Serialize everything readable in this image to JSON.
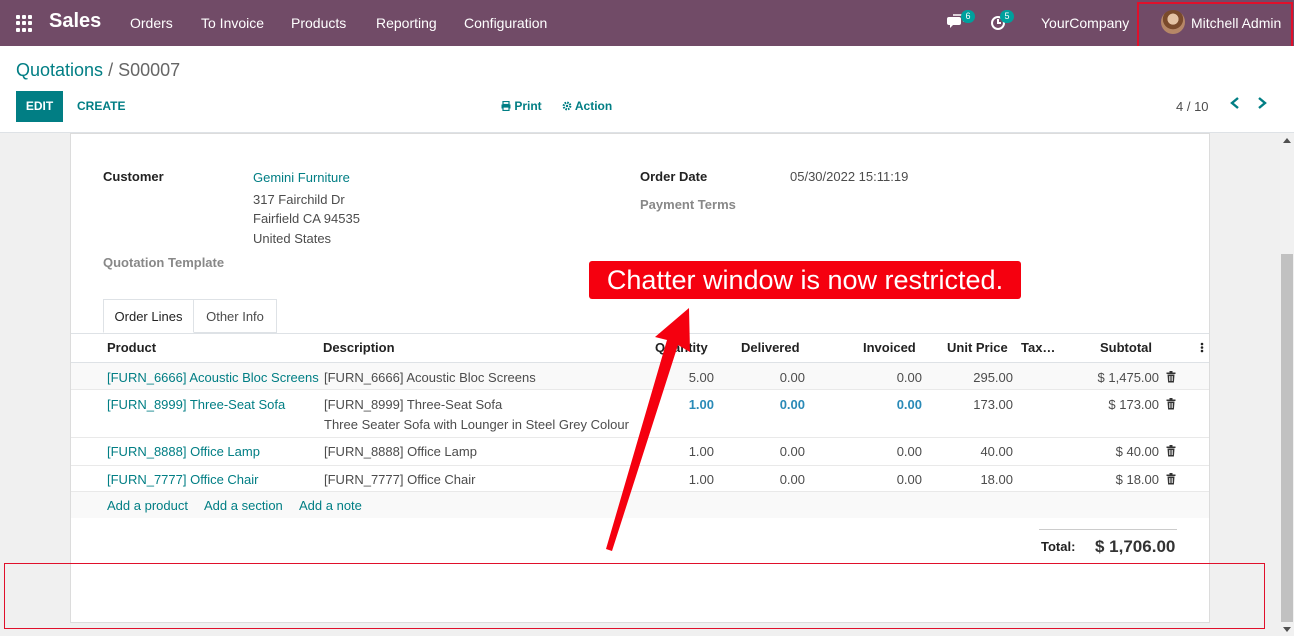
{
  "navbar": {
    "brand": "Sales",
    "menus": [
      "Orders",
      "To Invoice",
      "Products",
      "Reporting",
      "Configuration"
    ],
    "messages_badge": "6",
    "activities_badge": "5",
    "company": "YourCompany",
    "user": "Mitchell Admin",
    "color": "#714b67"
  },
  "breadcrumb": {
    "parent": "Quotations",
    "separator": "/",
    "current": "S00007"
  },
  "toolbar": {
    "edit": "EDIT",
    "create": "CREATE",
    "print": "Print",
    "action": "Action"
  },
  "pager": {
    "value": "4 / 10"
  },
  "form": {
    "customer_label": "Customer",
    "customer_name": "Gemini Furniture",
    "address_line1": "317 Fairchild Dr",
    "address_line2": "Fairfield CA 94535",
    "address_line3": "United States",
    "quotation_template_label": "Quotation Template",
    "order_date_label": "Order Date",
    "order_date": "05/30/2022 15:11:19",
    "payment_terms_label": "Payment Terms"
  },
  "tabs": [
    "Order Lines",
    "Other Info"
  ],
  "table": {
    "headers": {
      "product": "Product",
      "description": "Description",
      "quantity": "Quantity",
      "delivered": "Delivered",
      "invoiced": "Invoiced",
      "unit_price": "Unit Price",
      "taxes": "Tax…",
      "subtotal": "Subtotal"
    },
    "rows": [
      {
        "product": "[FURN_6666] Acoustic Bloc Screens",
        "description": "[FURN_6666] Acoustic Bloc Screens",
        "description2": "",
        "quantity": "5.00",
        "delivered": "0.00",
        "invoiced": "0.00",
        "unit_price": "295.00",
        "subtotal": "$ 1,475.00"
      },
      {
        "product": "[FURN_8999] Three-Seat Sofa",
        "description": "[FURN_8999] Three-Seat Sofa",
        "description2": "Three Seater Sofa with Lounger in Steel Grey Colour",
        "quantity": "1.00",
        "delivered": "0.00",
        "invoiced": "0.00",
        "unit_price": "173.00",
        "subtotal": "$ 173.00"
      },
      {
        "product": "[FURN_8888] Office Lamp",
        "description": "[FURN_8888] Office Lamp",
        "description2": "",
        "quantity": "1.00",
        "delivered": "0.00",
        "invoiced": "0.00",
        "unit_price": "40.00",
        "subtotal": "$ 40.00"
      },
      {
        "product": "[FURN_7777] Office Chair",
        "description": "[FURN_7777] Office Chair",
        "description2": "",
        "quantity": "1.00",
        "delivered": "0.00",
        "invoiced": "0.00",
        "unit_price": "18.00",
        "subtotal": "$ 18.00"
      }
    ],
    "add_product": "Add a product",
    "add_section": "Add a section",
    "add_note": "Add a note"
  },
  "totals": {
    "label": "Total:",
    "value": "$ 1,706.00"
  },
  "annotation": {
    "text": "Chatter window is now restricted.",
    "color": "#f5000f"
  }
}
